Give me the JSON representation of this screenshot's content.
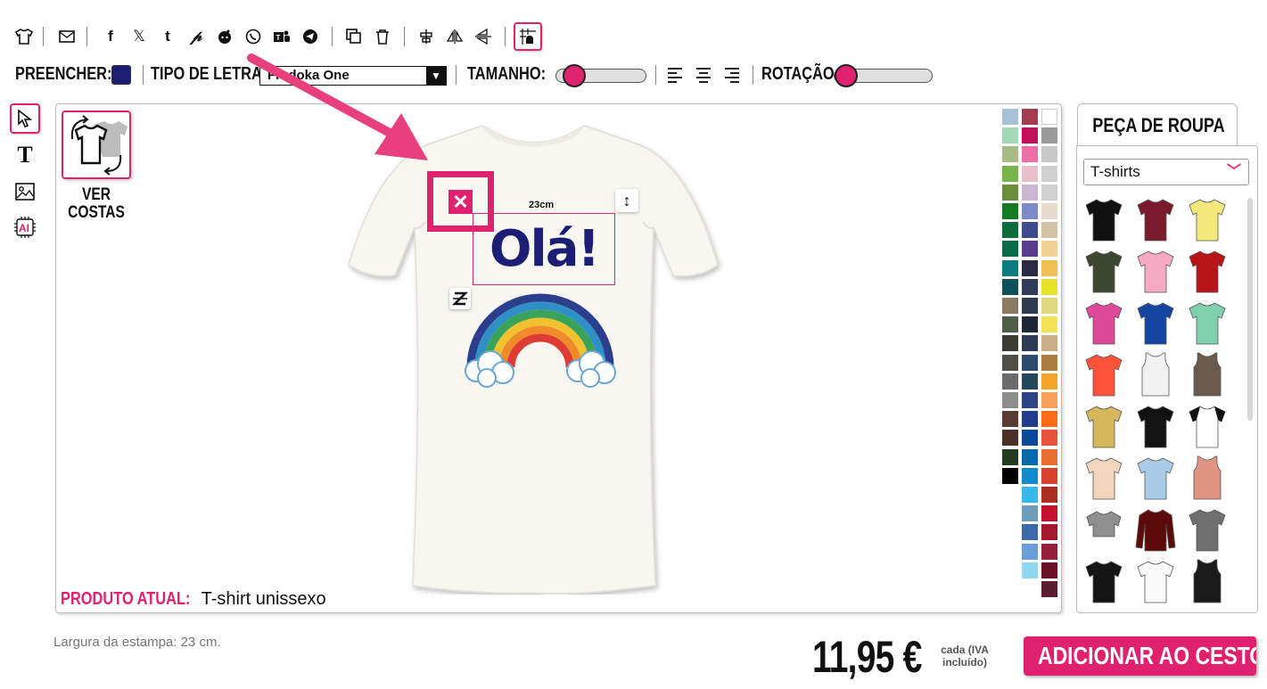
{
  "toolbar": {
    "icons": [
      "tshirt-icon",
      "email-icon",
      "facebook-icon",
      "x-twitter-icon",
      "tumblr-icon",
      "pinterest-icon",
      "reddit-icon",
      "whatsapp-icon",
      "teams-icon",
      "telegram-icon",
      "duplicate-icon",
      "trash-icon",
      "align-center-icon",
      "flip-horizontal-icon",
      "flip-vertical-icon",
      "grid-snap-icon"
    ]
  },
  "props": {
    "fill_label": "PREENCHER:",
    "fill_color": "#1c1d74",
    "font_label": "TIPO DE LETRA:",
    "font_value": "Fredoka One",
    "size_label": "TAMANHO:",
    "rotation_label": "ROTAÇÃO:",
    "size_slider": 0.1,
    "rotation_slider": 0.0
  },
  "design": {
    "text": "Olá!",
    "text_color": "#1c1d74",
    "width_label": "23cm",
    "view_back": "VER",
    "view_back2": "COSTAS"
  },
  "product": {
    "label": "PRODUTO ATUAL:",
    "name": "T-shirt unissexo"
  },
  "palette": {
    "col1": [
      "#a6c2d9",
      "#a6d7b6",
      "#a7bb85",
      "#79b44a",
      "#6a8e3c",
      "#127d22",
      "#0b6c3c",
      "#086b47",
      "#0d7b80",
      "#0e5159",
      "#8b7a5e",
      "#4e5d47",
      "#3a3a33",
      "#514e48",
      "#6b6b6b",
      "#8d8d8d",
      "#5c3b35",
      "#4b3028",
      "#253b23",
      "#000000"
    ],
    "col2": [
      "#a33b51",
      "#c2105a",
      "#ee6fa8",
      "#e7bfcd",
      "#c9b7d4",
      "#7d8ac8",
      "#404a8e",
      "#5a3d8e",
      "#2a2a44",
      "#323a5c",
      "#2f3c4f",
      "#1f2638",
      "#2d3a52",
      "#2c4b6e",
      "#27485a",
      "#2e4385",
      "#223c8c",
      "#0a4a9a",
      "#0069a8",
      "#0e8cd0",
      "#35b9ea",
      "#6f9cbd",
      "#3d6aa8",
      "#6a9ed9",
      "#8fd8f2"
    ],
    "col3": [
      "#ffffff",
      "#9a9a9a",
      "#c8c8c8",
      "#d0d0d0",
      "#cfcfcf",
      "#e5dccd",
      "#d3c2a5",
      "#f2d197",
      "#f0bf55",
      "#e6e22b",
      "#e0d67d",
      "#f1e355",
      "#c9ae85",
      "#a87d3f",
      "#f5a52a",
      "#f7a15f",
      "#ff6a13",
      "#e6533e",
      "#e76f32",
      "#d9412f",
      "#ab2d1d",
      "#c5112f",
      "#a4172c",
      "#961f3e",
      "#6b0f26",
      "#5c1d30"
    ]
  },
  "garments": {
    "tab_label": "PEÇA DE ROUPA",
    "category": "T-shirts",
    "items": [
      {
        "color": "#111111",
        "kind": "tee"
      },
      {
        "color": "#7b1a2e",
        "kind": "tee"
      },
      {
        "color": "#f3e879",
        "kind": "tee"
      },
      {
        "color": "#3c4630",
        "kind": "tee"
      },
      {
        "color": "#f5aac4",
        "kind": "tee"
      },
      {
        "color": "#b81418",
        "kind": "tee"
      },
      {
        "color": "#e0489a",
        "kind": "tee"
      },
      {
        "color": "#1545a3",
        "kind": "tee"
      },
      {
        "color": "#7fd0ae",
        "kind": "tee"
      },
      {
        "color": "#ff5338",
        "kind": "tee"
      },
      {
        "color": "#f2f2f2",
        "kind": "tank"
      },
      {
        "color": "#6a5a4e",
        "kind": "tank"
      },
      {
        "color": "#d6b85c",
        "kind": "tee"
      },
      {
        "color": "#121212",
        "kind": "tee"
      },
      {
        "color": "#ffffff",
        "kind": "raglan"
      },
      {
        "color": "#f1d5bd",
        "kind": "tee"
      },
      {
        "color": "#a9cce8",
        "kind": "tee"
      },
      {
        "color": "#e09482",
        "kind": "tank"
      },
      {
        "color": "#8f8f8f",
        "kind": "crop"
      },
      {
        "color": "#5c0a0a",
        "kind": "long"
      },
      {
        "color": "#6f6f6f",
        "kind": "tee"
      },
      {
        "color": "#151515",
        "kind": "tee"
      },
      {
        "color": "#fafafa",
        "kind": "tee"
      },
      {
        "color": "#1a1a1a",
        "kind": "tank"
      }
    ]
  },
  "footer": {
    "print_width": "Largura da estampa: 23 cm.",
    "price": "11,95 €",
    "cada_line1": "cada (IVA",
    "cada_line2": "incluído)",
    "add_to_cart": "ADICIONAR AO CESTO"
  }
}
